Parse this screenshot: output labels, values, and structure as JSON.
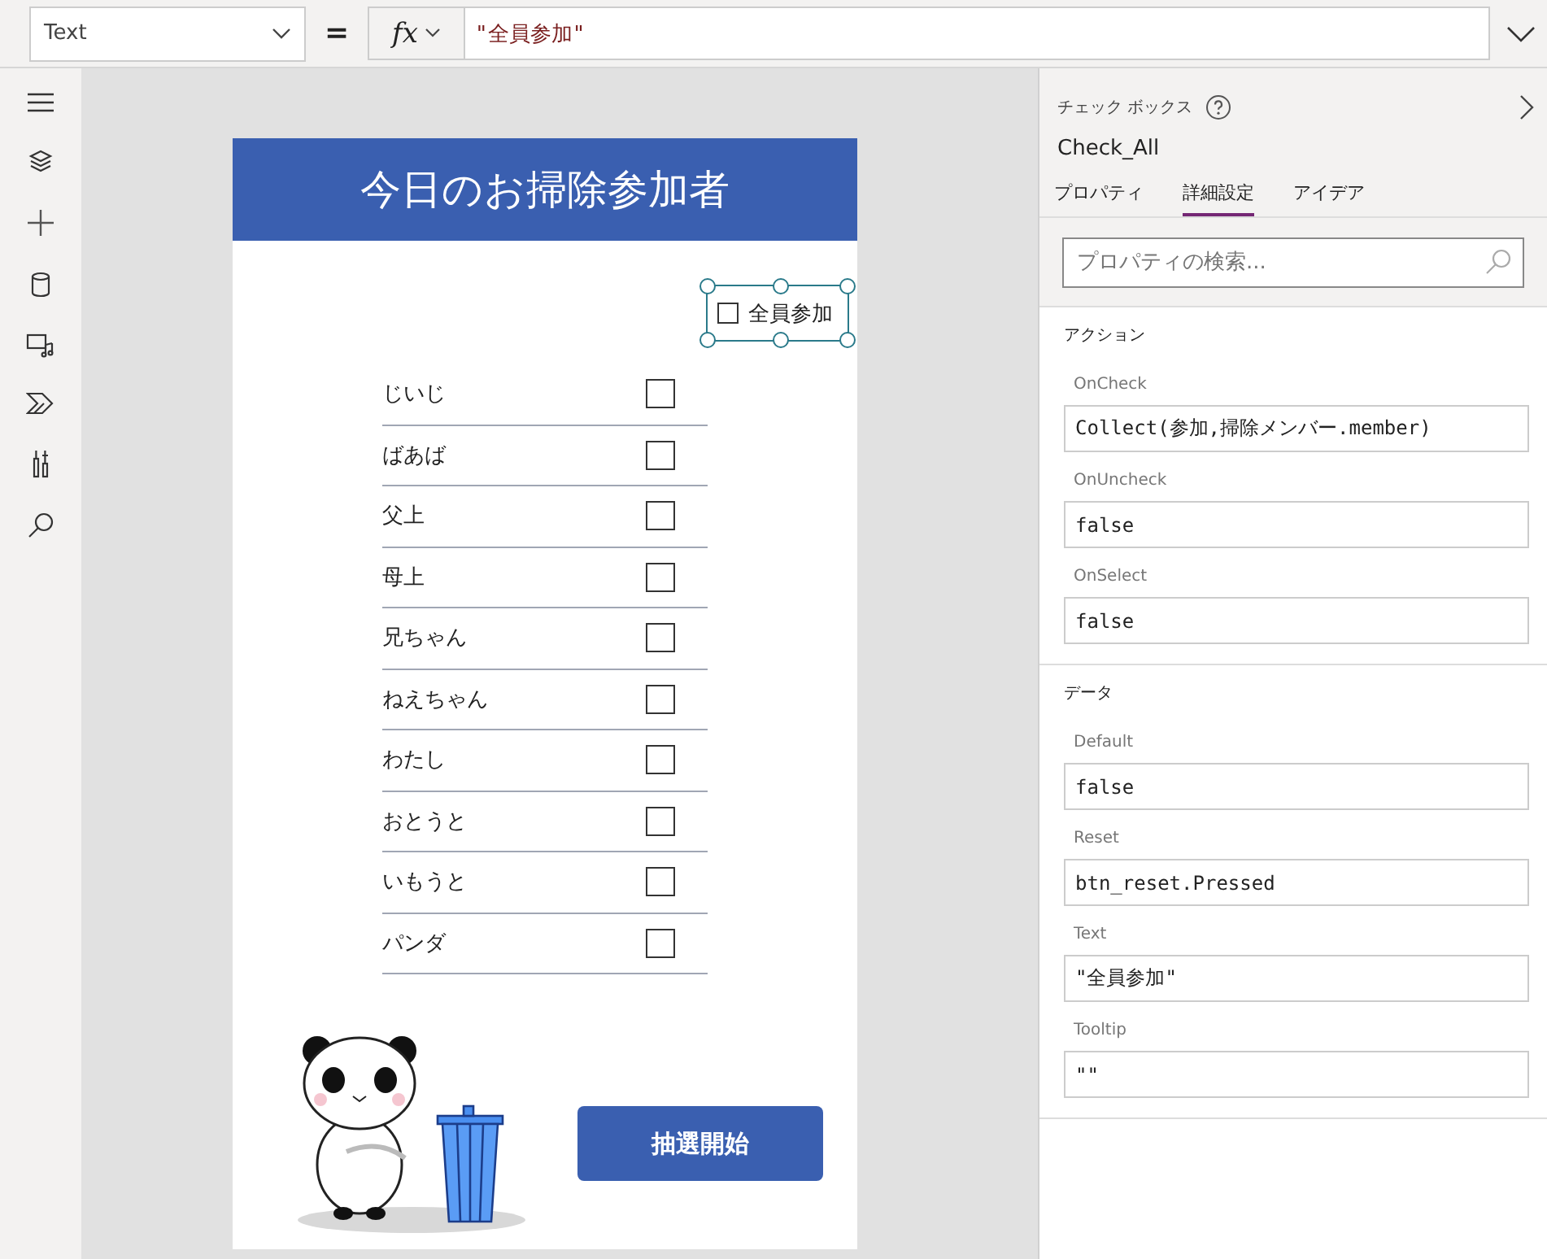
{
  "formula_bar": {
    "property": "Text",
    "equals": "=",
    "fx": "fx",
    "formula": "\"全員参加\""
  },
  "canvas": {
    "title": "今日のお掃除参加者",
    "select_all": {
      "label": "全員参加",
      "checked": false,
      "selected": true
    },
    "members": [
      {
        "name": "じいじ",
        "checked": false
      },
      {
        "name": "ばあば",
        "checked": false
      },
      {
        "name": "父上",
        "checked": false
      },
      {
        "name": "母上",
        "checked": false
      },
      {
        "name": "兄ちゃん",
        "checked": false
      },
      {
        "name": "ねえちゃん",
        "checked": false
      },
      {
        "name": "わたし",
        "checked": false
      },
      {
        "name": "おとうと",
        "checked": false
      },
      {
        "name": "いもうと",
        "checked": false
      },
      {
        "name": "パンダ",
        "checked": false
      }
    ],
    "button": "抽選開始"
  },
  "panel": {
    "control_type": "チェック ボックス",
    "control_name": "Check_All",
    "tabs": [
      {
        "label": "プロパティ",
        "selected": false
      },
      {
        "label": "詳細設定",
        "selected": true
      },
      {
        "label": "アイデア",
        "selected": false
      }
    ],
    "search": {
      "placeholder": "プロパティの検索..."
    },
    "sections": [
      {
        "title": "アクション",
        "properties": [
          {
            "label": "OnCheck",
            "value": "Collect(参加,掃除メンバー.member)"
          },
          {
            "label": "OnUncheck",
            "value": "false"
          },
          {
            "label": "OnSelect",
            "value": "false"
          }
        ]
      },
      {
        "title": "データ",
        "properties": [
          {
            "label": "Default",
            "value": "false"
          },
          {
            "label": "Reset",
            "value": "btn_reset.Pressed"
          },
          {
            "label": "Text",
            "value": "\"全員参加\""
          },
          {
            "label": "Tooltip",
            "value": "\"\""
          }
        ]
      }
    ]
  }
}
